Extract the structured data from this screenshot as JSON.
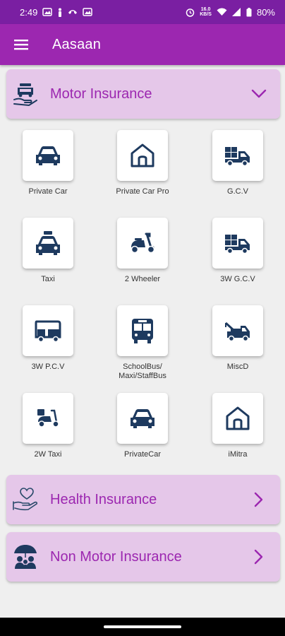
{
  "status_bar": {
    "time": "2:49",
    "net_rate_top": "16.0",
    "net_rate_bottom": "KB/S",
    "battery": "80%"
  },
  "app_bar": {
    "title": "Aasaan",
    "menu_icon": "hamburger-menu-icon"
  },
  "sections": {
    "motor": {
      "label": "Motor Insurance",
      "icon": "car-insurance-hand-icon",
      "state": "expanded",
      "items": [
        {
          "label": "Private Car",
          "icon": "car-icon"
        },
        {
          "label": "Private Car Pro",
          "icon": "house-icon"
        },
        {
          "label": "G.C.V",
          "icon": "truck-icon"
        },
        {
          "label": "Taxi",
          "icon": "taxi-icon"
        },
        {
          "label": "2 Wheeler",
          "icon": "scooter-icon"
        },
        {
          "label": "3W G.C.V",
          "icon": "truck-icon"
        },
        {
          "label": "3W P.C.V",
          "icon": "auto-rickshaw-icon"
        },
        {
          "label": "SchoolBus/ Maxi/StaffBus",
          "icon": "bus-icon"
        },
        {
          "label": "MiscD",
          "icon": "tow-truck-icon"
        },
        {
          "label": "2W Taxi",
          "icon": "delivery-scooter-icon"
        },
        {
          "label": "PrivateCar",
          "icon": "car-icon"
        },
        {
          "label": "iMitra",
          "icon": "house-icon"
        }
      ]
    },
    "health": {
      "label": "Health Insurance",
      "icon": "heart-hand-icon",
      "state": "collapsed"
    },
    "non_motor": {
      "label": "Non Motor Insurance",
      "icon": "family-umbrella-icon",
      "state": "collapsed"
    }
  },
  "colors": {
    "status_bar": "#7a1fa2",
    "app_bar": "#9c27b0",
    "section_card": "#e5c7e9",
    "section_text": "#9c27b0",
    "icon_navy": "#1e3a5f",
    "background": "#efefef"
  }
}
